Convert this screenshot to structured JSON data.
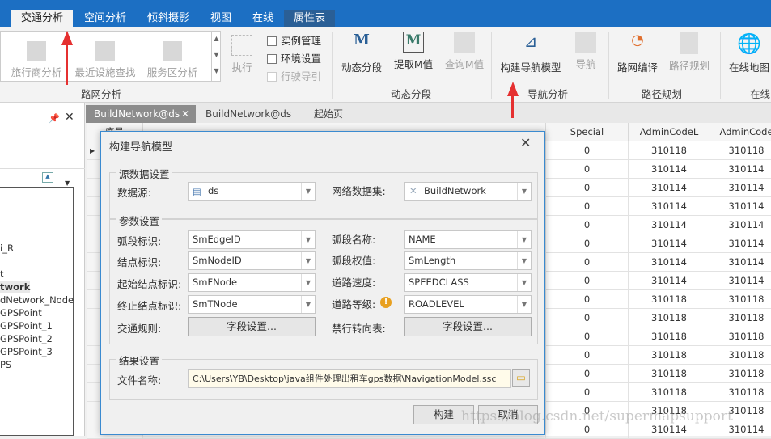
{
  "ribbon_tabs": [
    {
      "label": "交通分析",
      "selected": true
    },
    {
      "label": "空间分析"
    },
    {
      "label": "倾斜摄影"
    },
    {
      "label": "视图"
    },
    {
      "label": "在线"
    },
    {
      "label": "属性表",
      "contextual": true
    }
  ],
  "ribbon": {
    "road_network": {
      "group": "路网分析",
      "buttons": [
        "旅行商分析",
        "最近设施查找",
        "服务区分析"
      ],
      "execute": "执行",
      "checks": [
        {
          "label": "实例管理",
          "checked": false
        },
        {
          "label": "环境设置",
          "checked": false
        },
        {
          "label": "行驶导引",
          "checked": false,
          "disabled": true
        }
      ]
    },
    "dynamic": {
      "group": "动态分段",
      "buttons": [
        "动态分段",
        "提取M值",
        "查询M值"
      ]
    },
    "navigation": {
      "group": "导航分析",
      "buttons": [
        "构建导航模型",
        "导航"
      ]
    },
    "route": {
      "group": "路径规划",
      "buttons": [
        "路网编译",
        "路径规划"
      ]
    },
    "online": {
      "group": "在线",
      "buttons": [
        "在线地图"
      ]
    }
  },
  "left_panel": {
    "items": [
      "i_R",
      "t",
      "twork",
      "dNetwork_Node",
      "GPSPoint",
      "GPSPoint_1",
      "GPSPoint_2",
      "GPSPoint_3",
      "PS"
    ]
  },
  "doc_tabs": [
    {
      "label": "BuildNetwork@ds",
      "selected": true
    },
    {
      "label": "BuildNetwork@ds"
    },
    {
      "label": "起始页"
    }
  ],
  "grid": {
    "columns": [
      "序号",
      "Special",
      "AdminCodeL",
      "AdminCode"
    ],
    "rows": [
      [
        "0",
        "310118",
        "310118"
      ],
      [
        "0",
        "310114",
        "310114"
      ],
      [
        "0",
        "310114",
        "310114"
      ],
      [
        "0",
        "310114",
        "310114"
      ],
      [
        "0",
        "310114",
        "310114"
      ],
      [
        "0",
        "310114",
        "310114"
      ],
      [
        "0",
        "310114",
        "310114"
      ],
      [
        "0",
        "310114",
        "310114"
      ],
      [
        "0",
        "310118",
        "310118"
      ],
      [
        "0",
        "310118",
        "310118"
      ],
      [
        "0",
        "310118",
        "310118"
      ],
      [
        "0",
        "310118",
        "310118"
      ],
      [
        "0",
        "310118",
        "310118"
      ],
      [
        "0",
        "310118",
        "310118"
      ],
      [
        "0",
        "310118",
        "310118"
      ],
      [
        "0",
        "310114",
        "310114"
      ]
    ]
  },
  "dialog": {
    "title": "构建导航模型",
    "source": {
      "title": "源数据设置",
      "datasource_label": "数据源:",
      "datasource": "ds",
      "dataset_label": "网络数据集:",
      "dataset": "BuildNetwork"
    },
    "params": {
      "title": "参数设置",
      "left": [
        {
          "label": "弧段标识:",
          "value": "SmEdgeID"
        },
        {
          "label": "结点标识:",
          "value": "SmNodeID"
        },
        {
          "label": "起始结点标识:",
          "value": "SmFNode"
        },
        {
          "label": "终止结点标识:",
          "value": "SmTNode"
        }
      ],
      "right": [
        {
          "label": "弧段名称:",
          "value": "NAME"
        },
        {
          "label": "弧段权值:",
          "value": "SmLength"
        },
        {
          "label": "道路速度:",
          "value": "SPEEDCLASS"
        },
        {
          "label": "道路等级:",
          "value": "ROADLEVEL",
          "warning": true
        }
      ],
      "traffic_rule_label": "交通规则:",
      "forbidden_label": "禁行转向表:",
      "field_button": "字段设置..."
    },
    "result": {
      "title": "结果设置",
      "file_label": "文件名称:",
      "file": "C:\\Users\\YB\\Desktop\\java组件处理出租车gps数据\\NavigationModel.ssc"
    },
    "ok": "构建",
    "cancel": "取消"
  },
  "watermark": "https://blog.csdn.net/supermapsupport",
  "colors": {
    "accent": "#1c6fc3",
    "annotation_arrow": "#e53030",
    "warning": "#e8a020"
  }
}
